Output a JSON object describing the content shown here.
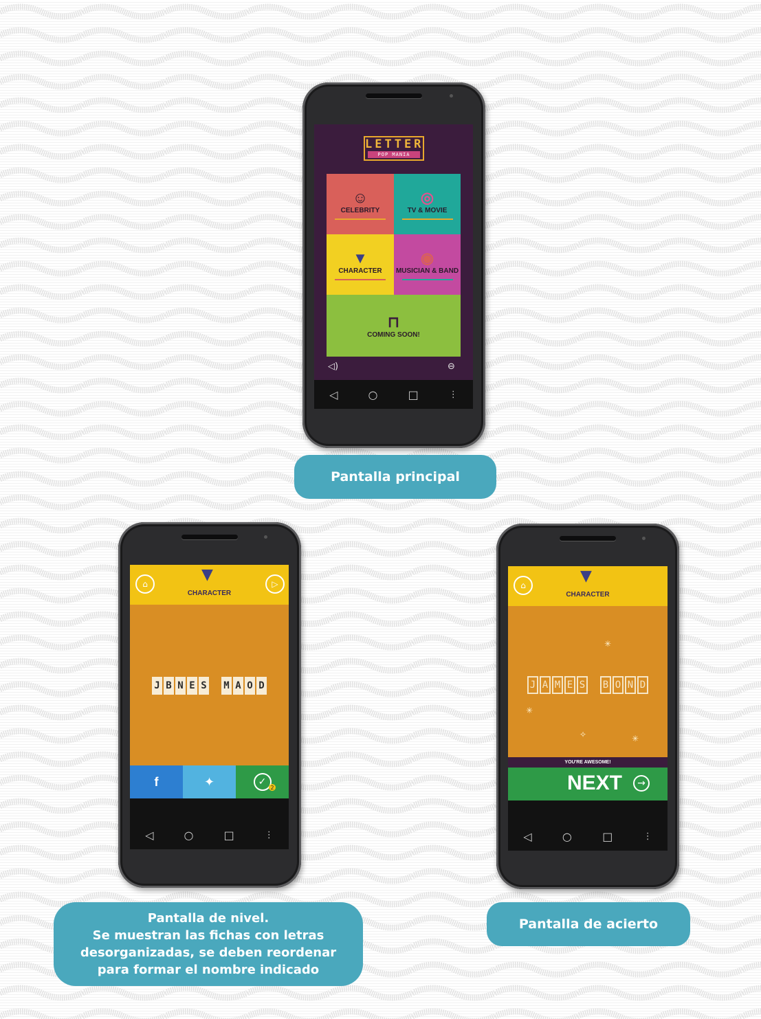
{
  "colors": {
    "caption_bg": "#4aa8bd",
    "main_bg": "#3b1c3d",
    "celebrity_tile": "#d9605a",
    "tv_movie_tile": "#20a89a",
    "character_tile": "#f2d022",
    "musician_tile": "#c34aa0",
    "coming_soon_tile": "#8cbf3f",
    "level_header": "#f2c314",
    "level_play_area": "#d98e24",
    "facebook": "#2d7fd1",
    "twitter": "#52b3e0",
    "check": "#2e9a47",
    "next_bar": "#2e9a47"
  },
  "main_screen": {
    "logo": {
      "line1": "LETTER",
      "line2": "POP MANIA"
    },
    "tiles": [
      {
        "label": "CELEBRITY",
        "icon": "celebrity-face-icon"
      },
      {
        "label": "TV & MOVIE",
        "icon": "donut-icon"
      },
      {
        "label": "CHARACTER",
        "icon": "bat-mask-icon"
      },
      {
        "label": "MUSICIAN & BAND",
        "icon": "mouth-icon"
      },
      {
        "label": "COMING SOON!",
        "icon": "barrier-icon"
      }
    ],
    "sound_icon": "speaker-icon",
    "games_icon": "gamepad-icon",
    "caption": "Pantalla principal"
  },
  "level_screen": {
    "category": "CHARACTER",
    "home_icon": "home-icon",
    "skip_icon": "skip-icon",
    "scrambled_word1": [
      "J",
      "B",
      "N",
      "E",
      "S"
    ],
    "scrambled_word2": [
      "M",
      "A",
      "O",
      "D"
    ],
    "facebook_icon": "facebook-icon",
    "twitter_icon": "twitter-icon",
    "check_icon": "check-icon",
    "check_badge": "2",
    "caption_lines": [
      "Pantalla de nivel.",
      "Se muestran las fichas con letras",
      "desorganizadas, se deben reordenar",
      "para formar el nombre indicado"
    ]
  },
  "success_screen": {
    "category": "CHARACTER",
    "home_icon": "home-icon",
    "solved_word1": [
      "J",
      "A",
      "M",
      "E",
      "S"
    ],
    "solved_word2": [
      "B",
      "O",
      "N",
      "D"
    ],
    "message": "YOU'RE AWESOME!",
    "next_label": "NEXT",
    "next_icon": "arrow-right-icon",
    "caption": "Pantalla de acierto"
  },
  "android_nav": {
    "back": "◁",
    "home": "○",
    "recents": "□",
    "menu": "⋮"
  }
}
